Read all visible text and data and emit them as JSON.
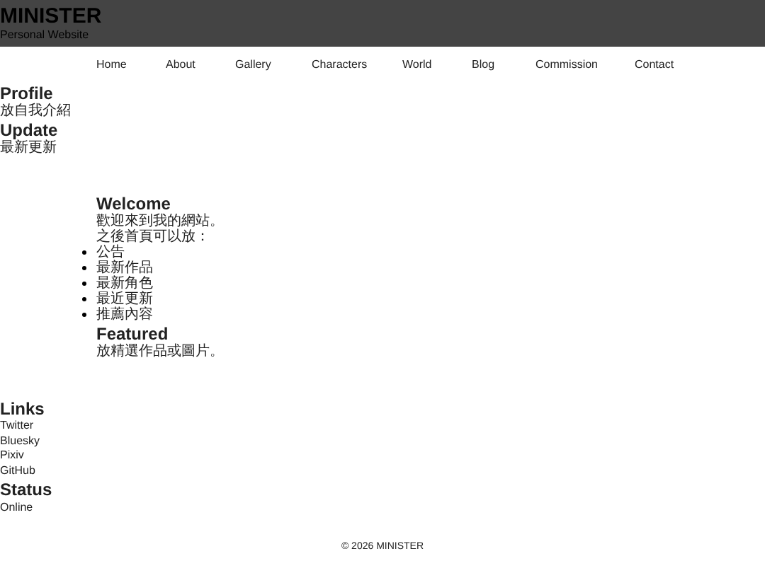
{
  "header": {
    "title": "MINISTER",
    "subtitle": "Personal Website"
  },
  "nav": [
    "Home",
    "About",
    "Gallery",
    "Characters",
    "World",
    "Blog",
    "Commission",
    "Contact"
  ],
  "sidebar_top": [
    {
      "heading": "Profile",
      "lines": [
        "放自我介紹"
      ]
    },
    {
      "heading": "Update",
      "lines": [
        "最新更新"
      ]
    }
  ],
  "main": {
    "welcome": {
      "heading": "Welcome",
      "lines": [
        "歡迎來到我的網站。",
        "之後首頁可以放："
      ],
      "items": [
        "公告",
        "最新作品",
        "最新角色",
        "最近更新",
        "推薦內容"
      ]
    },
    "featured": {
      "heading": "Featured",
      "lines": [
        "放精選作品或圖片。"
      ]
    }
  },
  "sidebar_bottom": [
    {
      "heading": "Links",
      "lines": [
        "Twitter",
        "Bluesky",
        "Pixiv",
        "GitHub"
      ],
      "kind": "links"
    },
    {
      "heading": "Status",
      "lines": [
        "Online"
      ],
      "kind": "text"
    }
  ],
  "footer": "© 2026 MINISTER"
}
